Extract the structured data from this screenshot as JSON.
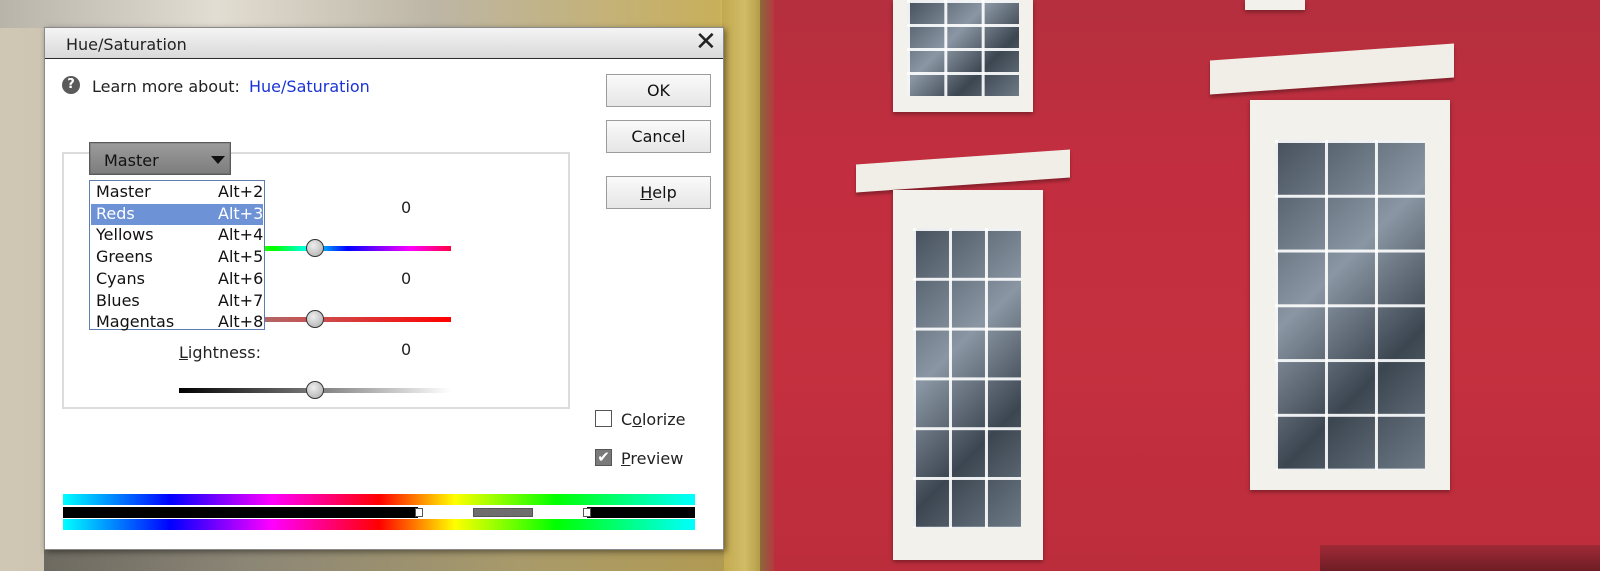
{
  "dialog": {
    "title": "Hue/Saturation",
    "close_glyph": "✕",
    "learn_prefix": "Learn more about:",
    "learn_link": "Hue/Saturation",
    "help_icon": "?"
  },
  "buttons": {
    "ok": "OK",
    "cancel": "Cancel",
    "help_pre": "",
    "help_u": "H",
    "help_post": "elp"
  },
  "channel": {
    "selected": "Master",
    "options": [
      {
        "label": "Master",
        "shortcut": "Alt+2",
        "highlighted": false
      },
      {
        "label": "Reds",
        "shortcut": "Alt+3",
        "highlighted": true
      },
      {
        "label": "Yellows",
        "shortcut": "Alt+4",
        "highlighted": false
      },
      {
        "label": "Greens",
        "shortcut": "Alt+5",
        "highlighted": false
      },
      {
        "label": "Cyans",
        "shortcut": "Alt+6",
        "highlighted": false
      },
      {
        "label": "Blues",
        "shortcut": "Alt+7",
        "highlighted": false
      },
      {
        "label": "Magentas",
        "shortcut": "Alt+8",
        "highlighted": false
      }
    ]
  },
  "sliders": {
    "hue": {
      "value": "0"
    },
    "saturation": {
      "value": "0"
    },
    "lightness": {
      "label_pre": "",
      "label_u": "L",
      "label_post": "ightness:",
      "value": "0"
    }
  },
  "options": {
    "colorize": {
      "label_pre": "C",
      "label_u": "o",
      "label_post": "lorize",
      "checked": false
    },
    "preview": {
      "label_pre": "",
      "label_u": "P",
      "label_post": "review",
      "checked": true,
      "check_glyph": "✔"
    }
  },
  "colors": {
    "link": "#1a33d6",
    "menu_highlight": "#6d93d6",
    "photo_wall": "#c22e3f"
  }
}
